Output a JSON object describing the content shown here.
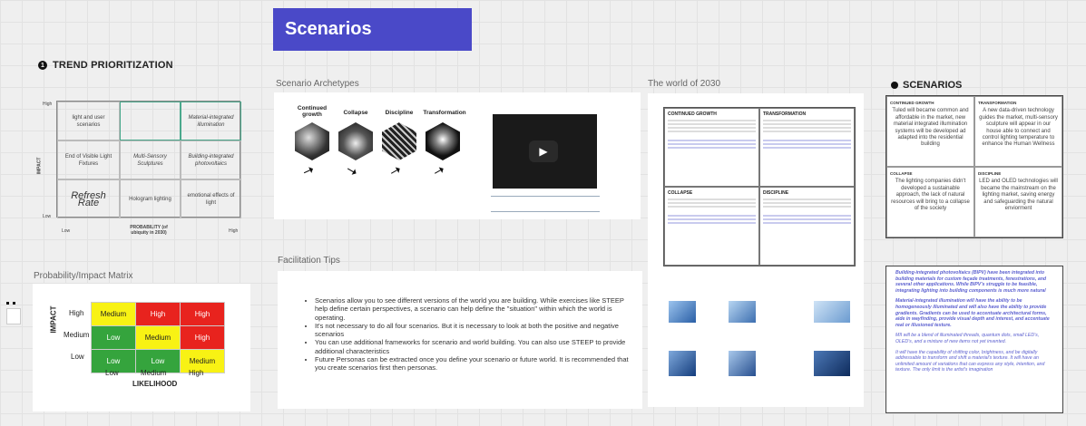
{
  "title": "Scenarios",
  "trend": {
    "number": "1",
    "heading": "TREND PRIORITIZATION",
    "cells": [
      "light and user scenarios",
      "",
      "Material-integrated illumination",
      "End of Visible Light Fixtures",
      "Multi-Sensory Sculptures",
      "Building-integrated photovoltaics",
      "Refresh Rate",
      "Hologram lighting",
      "emotional effects of light"
    ],
    "y_axis": "IMPACT",
    "y_high": "High",
    "y_low": "Low",
    "x_low": "Low",
    "x_high": "High",
    "x_axis": "PROBABILITY (of ubiquity in 2030)"
  },
  "pim": {
    "label": "Probability/Impact Matrix",
    "rows": [
      {
        "label": "High",
        "cells": [
          [
            "Medium",
            "yellow"
          ],
          [
            "High",
            "red"
          ],
          [
            "High",
            "red"
          ]
        ]
      },
      {
        "label": "Medium",
        "cells": [
          [
            "Low",
            "green"
          ],
          [
            "Medium",
            "yellow"
          ],
          [
            "High",
            "red"
          ]
        ]
      },
      {
        "label": "Low",
        "cells": [
          [
            "Low",
            "green"
          ],
          [
            "Low",
            "green"
          ],
          [
            "Medium",
            "yellow"
          ]
        ]
      }
    ],
    "cols": [
      "Low",
      "Medium",
      "High"
    ],
    "y_axis": "IMPACT",
    "x_axis": "LIKELIHOOD",
    "colors": {
      "red": "#e8231e",
      "yellow": "#f8f214",
      "green": "#35a43d"
    }
  },
  "archetypes": {
    "label": "Scenario Archetypes",
    "items": [
      "Continued growth",
      "Collapse",
      "Discipline",
      "Transformation"
    ]
  },
  "tips": {
    "label": "Facilitation Tips",
    "items": [
      "Scenarios allow you to see different versions of the world you are building. While exercises like STEEP help define certain perspectives, a scenario can help define the \"situation\" within which the world is operating.",
      "It's not necessary to do all four scenarios. But it is necessary to look at both the positive and negative scenarios",
      "You can use additional frameworks for scenario and world building. You can also use STEEP to provide additional characteristics",
      "Future Personas can be extracted once you define your scenario or future world. It is recommended that you create scenarios first then personas."
    ]
  },
  "world": {
    "label": "The world of 2030",
    "cells": [
      "CONTINUED GROWTH",
      "TRANSFORMATION",
      "COLLAPSE",
      "DISCIPLINE"
    ]
  },
  "scenarios": {
    "heading": "SCENARIOS",
    "cells": [
      {
        "h": "CONTINUED GROWTH",
        "t": "Tuled will became common and affordable in the market, new material integrated illumination systems will be developed ad adapted into the residential building"
      },
      {
        "h": "TRANSFORMATION",
        "t": "A new data-driven technology guides the market, multi-sensory sculpture will appear in our house able to connect and control lighting temperature to enhance the Human Wellness"
      },
      {
        "h": "COLLAPSE",
        "t": "The lighting companies didn't developed a sustainable approach, the lack of natural resources will bring to a collapse of the society"
      },
      {
        "h": "DISCIPLINE",
        "t": "LED and OLED technologies will became the mainstream on the lighting market, saving energy and safeguarding the natural enviorment"
      }
    ],
    "notes": [
      "Building-integrated photovoltaics (BIPV) have been integrated into building materials for custom façade treatments, fenestrations, and several other applications. While BIPV's struggle to be feasible, integrating lighting into building components is much more natural",
      "Material-integrated illumination will have the ability to be homogeneously illuminated and will also have the ability to provide gradients. Gradients can be used to accentuate architectural forms, aide in wayfinding, provide visual depth and interest, and accentuate real or illusioned texture.",
      "MII will be a blend of illuminated threads, quantum dots, small LED's, OLED's, and a mixture of new items not yet invented.",
      "It will have the capability of shifting color, brightness, and be digitally addressable to transform and shift a material's texture. It will have an unlimited amount of variations that can express any style, intention, and texture. The only limit is the artist's imagination"
    ]
  }
}
